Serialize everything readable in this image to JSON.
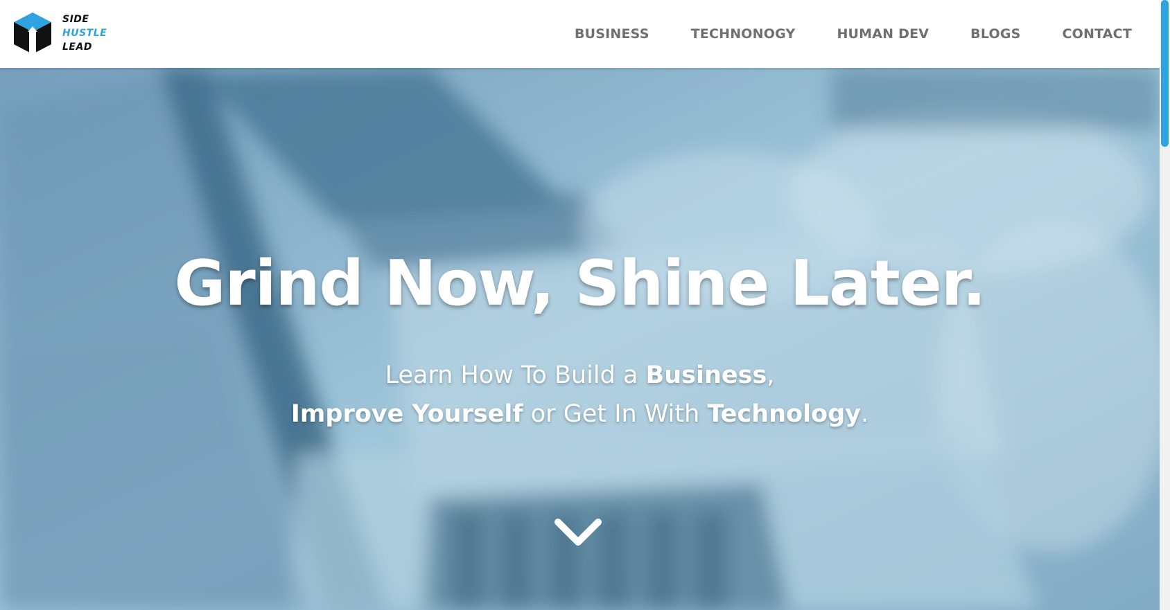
{
  "header": {
    "logo": {
      "lines": [
        "SIDE",
        "HUSTLE",
        "LEAD"
      ],
      "accent_color": "#2ea3e0"
    },
    "nav": [
      {
        "label": "BUSINESS"
      },
      {
        "label": "TECHNONOGY"
      },
      {
        "label": "HUMAN DEV"
      },
      {
        "label": "BLOGS"
      },
      {
        "label": "CONTACT"
      }
    ]
  },
  "hero": {
    "title": "Grind Now, Shine Later.",
    "subtitle": {
      "line1": {
        "pre": "Learn How To Build a ",
        "bold": "Business",
        "post": ","
      },
      "line2": {
        "bold1": "Improve Yourself",
        "mid": " or Get In With ",
        "bold2": "Technology",
        "post": "."
      }
    },
    "scroll_icon": "chevron-down-icon"
  },
  "colors": {
    "accent": "#2ea3e0",
    "nav_text": "#6f6f6f",
    "hero_overlay": "#8fb6cf"
  }
}
